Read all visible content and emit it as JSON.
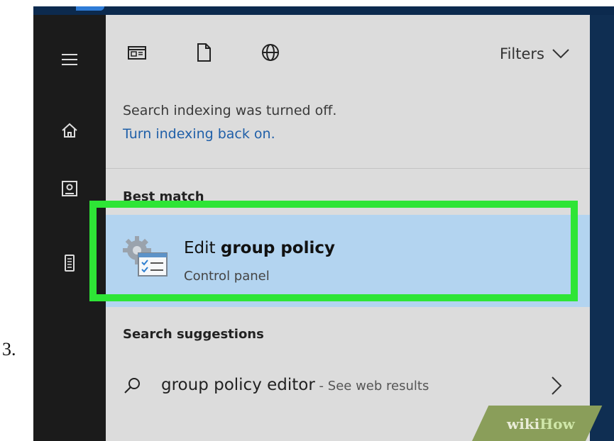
{
  "step_number": "3.",
  "sidebar": {
    "icons": [
      "hamburger-menu-icon",
      "home-icon",
      "notebook-icon",
      "device-icon"
    ]
  },
  "toolbar": {
    "icons": [
      "apps-icon",
      "documents-icon",
      "web-globe-icon"
    ],
    "filters_label": "Filters"
  },
  "notice": {
    "message": "Search indexing was turned off.",
    "action_link": "Turn indexing back on."
  },
  "best_match": {
    "section_label": "Best match",
    "title_prefix": "Edit",
    "title_bold": "group policy",
    "subtitle": "Control panel",
    "icon": "group-policy-icon",
    "highlight_color": "#2ee536"
  },
  "suggestions": {
    "section_label": "Search suggestions",
    "items": [
      {
        "query": "group policy editor",
        "separator": " - ",
        "hint": "See web results"
      }
    ]
  },
  "watermark": {
    "part1": "wiki",
    "part2": "How"
  },
  "colors": {
    "sidebar_bg": "#1b1b1b",
    "panel_bg": "#dcdcdc",
    "selected_bg": "#b3d4f0",
    "link": "#1f5fa8"
  }
}
